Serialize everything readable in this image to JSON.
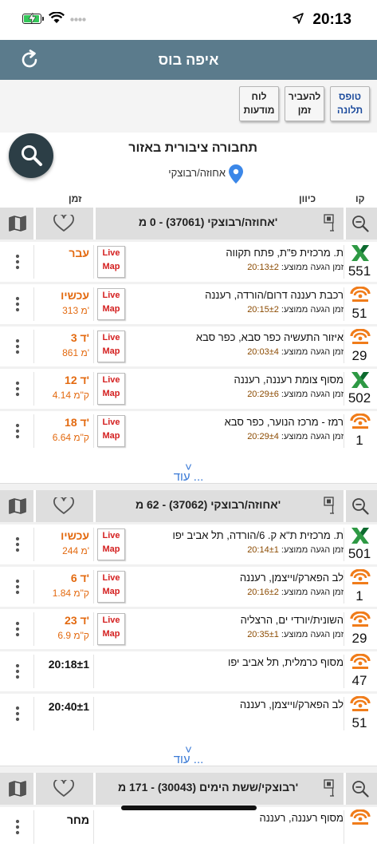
{
  "status": {
    "time": "20:13"
  },
  "header": {
    "title": "איפה בוס"
  },
  "toolbar": {
    "report": "טופס תלונה",
    "time": "להעביר זמן",
    "board": "לוח מודעות"
  },
  "area": {
    "title": "תחבורה ציבורית באזור",
    "address": "אחוזה/רבוצקי"
  },
  "columns": {
    "line": "קו",
    "direction": "כיוון",
    "time": "זמן"
  },
  "colors": {
    "header": "#5b7b8c",
    "eta": "#e36a10",
    "live": "#d42020",
    "more": "#3a7ad6"
  },
  "stops": [
    {
      "title": "אחוזה/רבוצקי (37061) - 0 מ'",
      "rows": [
        {
          "line": "551",
          "operator": "x-icon",
          "dest": "ת. מרכזית פ\"ת, פתח תקווה",
          "eta_label": "זמן הגעה ממוצע: ",
          "eta_time": "20:13±2",
          "main": "עבר",
          "sub": "",
          "live": true
        },
        {
          "line": "51",
          "operator": "metropoline-icon",
          "dest": "רכבת רעננה דרום/הורדה, רעננה",
          "eta_label": "זמן הגעה ממוצע: ",
          "eta_time": "20:15±2",
          "main": "עכשיו",
          "sub": "313 מ'",
          "live": true
        },
        {
          "line": "29",
          "operator": "metropoline-icon",
          "dest": "איזור התעשיה כפר סבא, כפר סבא",
          "eta_label": "זמן הגעה ממוצע: ",
          "eta_time": "20:03±4",
          "main": "3 ד'",
          "sub": "861 מ'",
          "live": true
        },
        {
          "line": "502",
          "operator": "x-icon",
          "dest": "מסוף צומת רעננה, רעננה",
          "eta_label": "זמן הגעה ממוצע: ",
          "eta_time": "20:29±6",
          "main": "12 ד'",
          "sub": "4.14 ק\"מ",
          "live": true
        },
        {
          "line": "1",
          "operator": "metropoline-icon",
          "dest": "רמז - מרכז הנוער, כפר סבא",
          "eta_label": "זמן הגעה ממוצע: ",
          "eta_time": "20:29±4",
          "main": "18 ד'",
          "sub": "6.64 ק\"מ",
          "live": true
        }
      ],
      "more": "עוד ..."
    },
    {
      "title": "אחוזה/רבוצקי (37062) - 62 מ'",
      "rows": [
        {
          "line": "501",
          "operator": "x-icon",
          "dest": "ת. מרכזית ת\"א ק. 6/הורדה, תל אביב יפו",
          "eta_label": "זמן הגעה ממוצע: ",
          "eta_time": "20:14±1",
          "main": "עכשיו",
          "sub": "244 מ'",
          "live": true
        },
        {
          "line": "1",
          "operator": "metropoline-icon",
          "dest": "לב הפארק/וייצמן, רעננה",
          "eta_label": "זמן הגעה ממוצע: ",
          "eta_time": "20:16±2",
          "main": "6 ד'",
          "sub": "1.84 ק\"מ",
          "live": true
        },
        {
          "line": "29",
          "operator": "metropoline-icon",
          "dest": "השונית/יורדי ים, הרצליה",
          "eta_label": "זמן הגעה ממוצע: ",
          "eta_time": "20:35±1",
          "main": "23 ד'",
          "sub": "6.9 ק\"מ",
          "live": true
        },
        {
          "line": "47",
          "operator": "metropoline-icon",
          "dest": "מסוף כרמלית, תל אביב יפו",
          "eta_label": "",
          "eta_time": "",
          "main": "20:18±1",
          "sub": "",
          "live": false
        },
        {
          "line": "51",
          "operator": "metropoline-icon",
          "dest": "לב הפארק/וייצמן, רעננה",
          "eta_label": "",
          "eta_time": "",
          "main": "20:40±1",
          "sub": "",
          "live": false
        }
      ],
      "more": "עוד ..."
    },
    {
      "title": "רבוצקי/ששת הימים (30043) - 171 מ'",
      "rows": [
        {
          "line": "",
          "operator": "metropoline-icon",
          "dest": "מסוף רעננה, רעננה",
          "eta_label": "",
          "eta_time": "",
          "main": "מחר",
          "sub": "",
          "live": false
        }
      ],
      "more": ""
    }
  ]
}
